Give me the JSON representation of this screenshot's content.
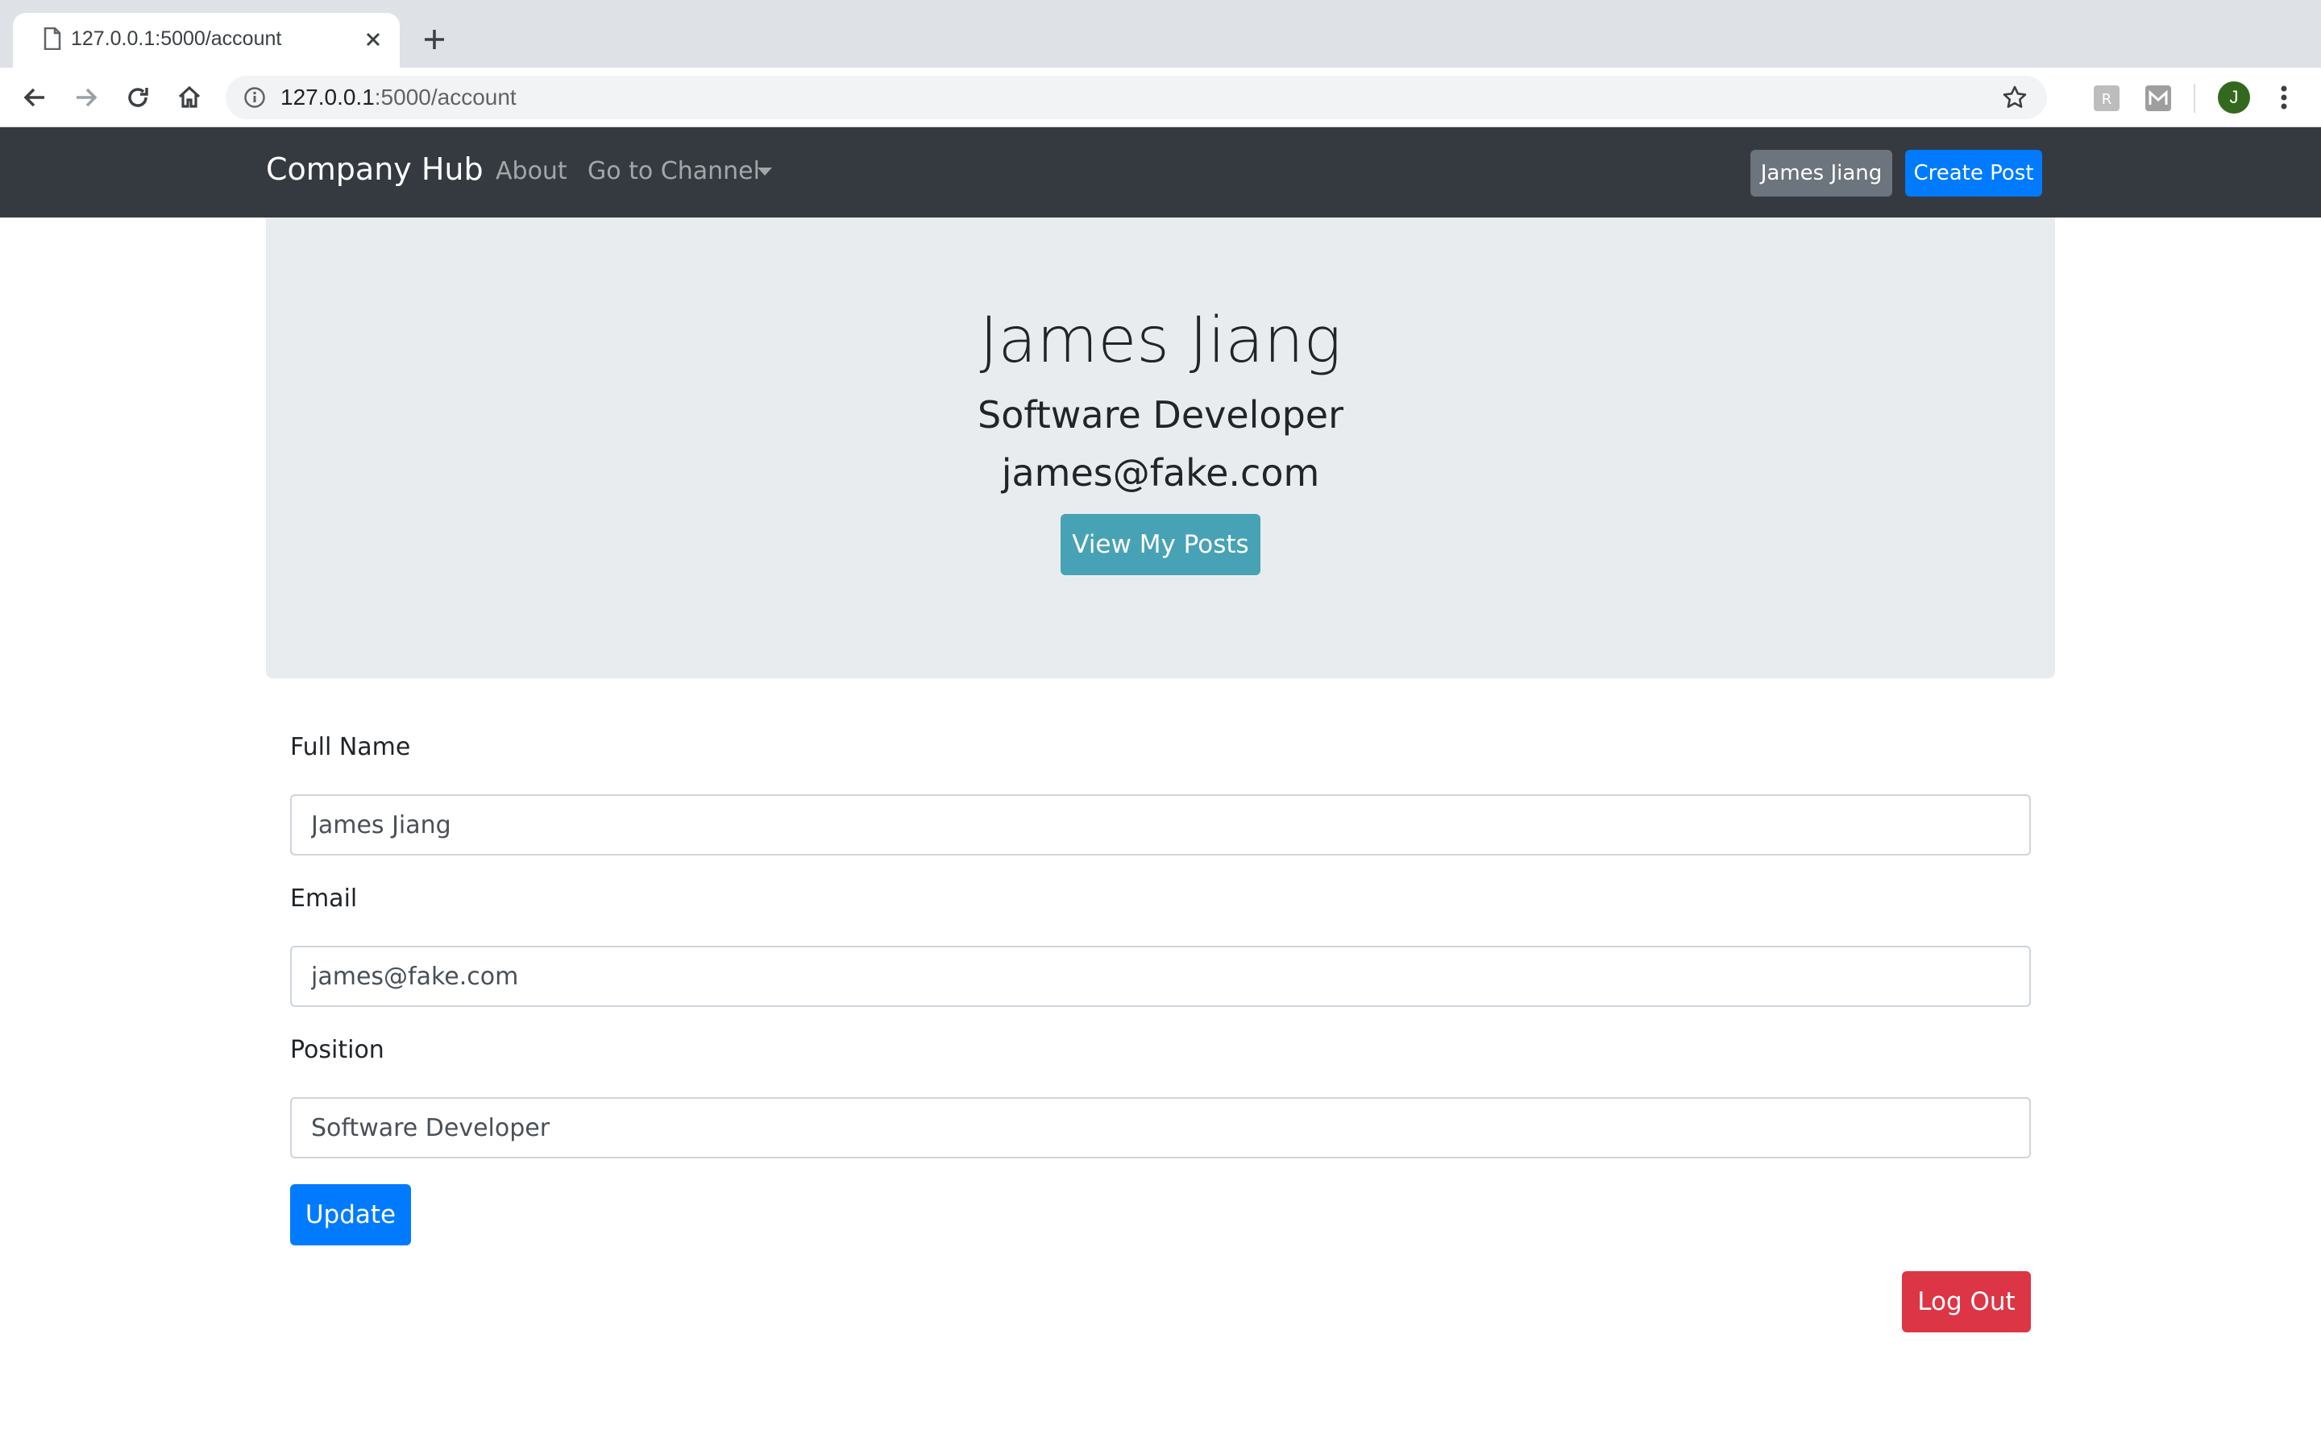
{
  "browser": {
    "tab_title": "127.0.0.1:5000/account",
    "url_host": "127.0.0.1",
    "url_path": ":5000/account",
    "profile_initial": "J",
    "icons": [
      "doc-icon",
      "close-icon",
      "plus-icon",
      "back-arrow-icon",
      "forward-arrow-icon",
      "reload-icon",
      "home-icon",
      "info-icon",
      "star-icon",
      "extension-icon",
      "kebab-menu-icon"
    ]
  },
  "navbar": {
    "brand": "Company Hub",
    "about": "About",
    "channel": "Go to Channel",
    "user_button": "James Jiang",
    "create_button": "Create Post"
  },
  "profile": {
    "name": "James Jiang",
    "position": "Software Developer",
    "email": "james@fake.com",
    "view_posts_button": "View My Posts"
  },
  "form": {
    "full_name_label": "Full Name",
    "full_name_value": "James Jiang",
    "email_label": "Email",
    "email_value": "james@fake.com",
    "position_label": "Position",
    "position_value": "Software Developer",
    "update_button": "Update",
    "logout_button": "Log Out"
  },
  "colors": {
    "navbar_bg": "#343a40",
    "primary": "#007bff",
    "secondary": "#6c757d",
    "info": "#47a2b5",
    "danger": "#dc3545",
    "jumbotron_bg": "#e9ecef"
  }
}
